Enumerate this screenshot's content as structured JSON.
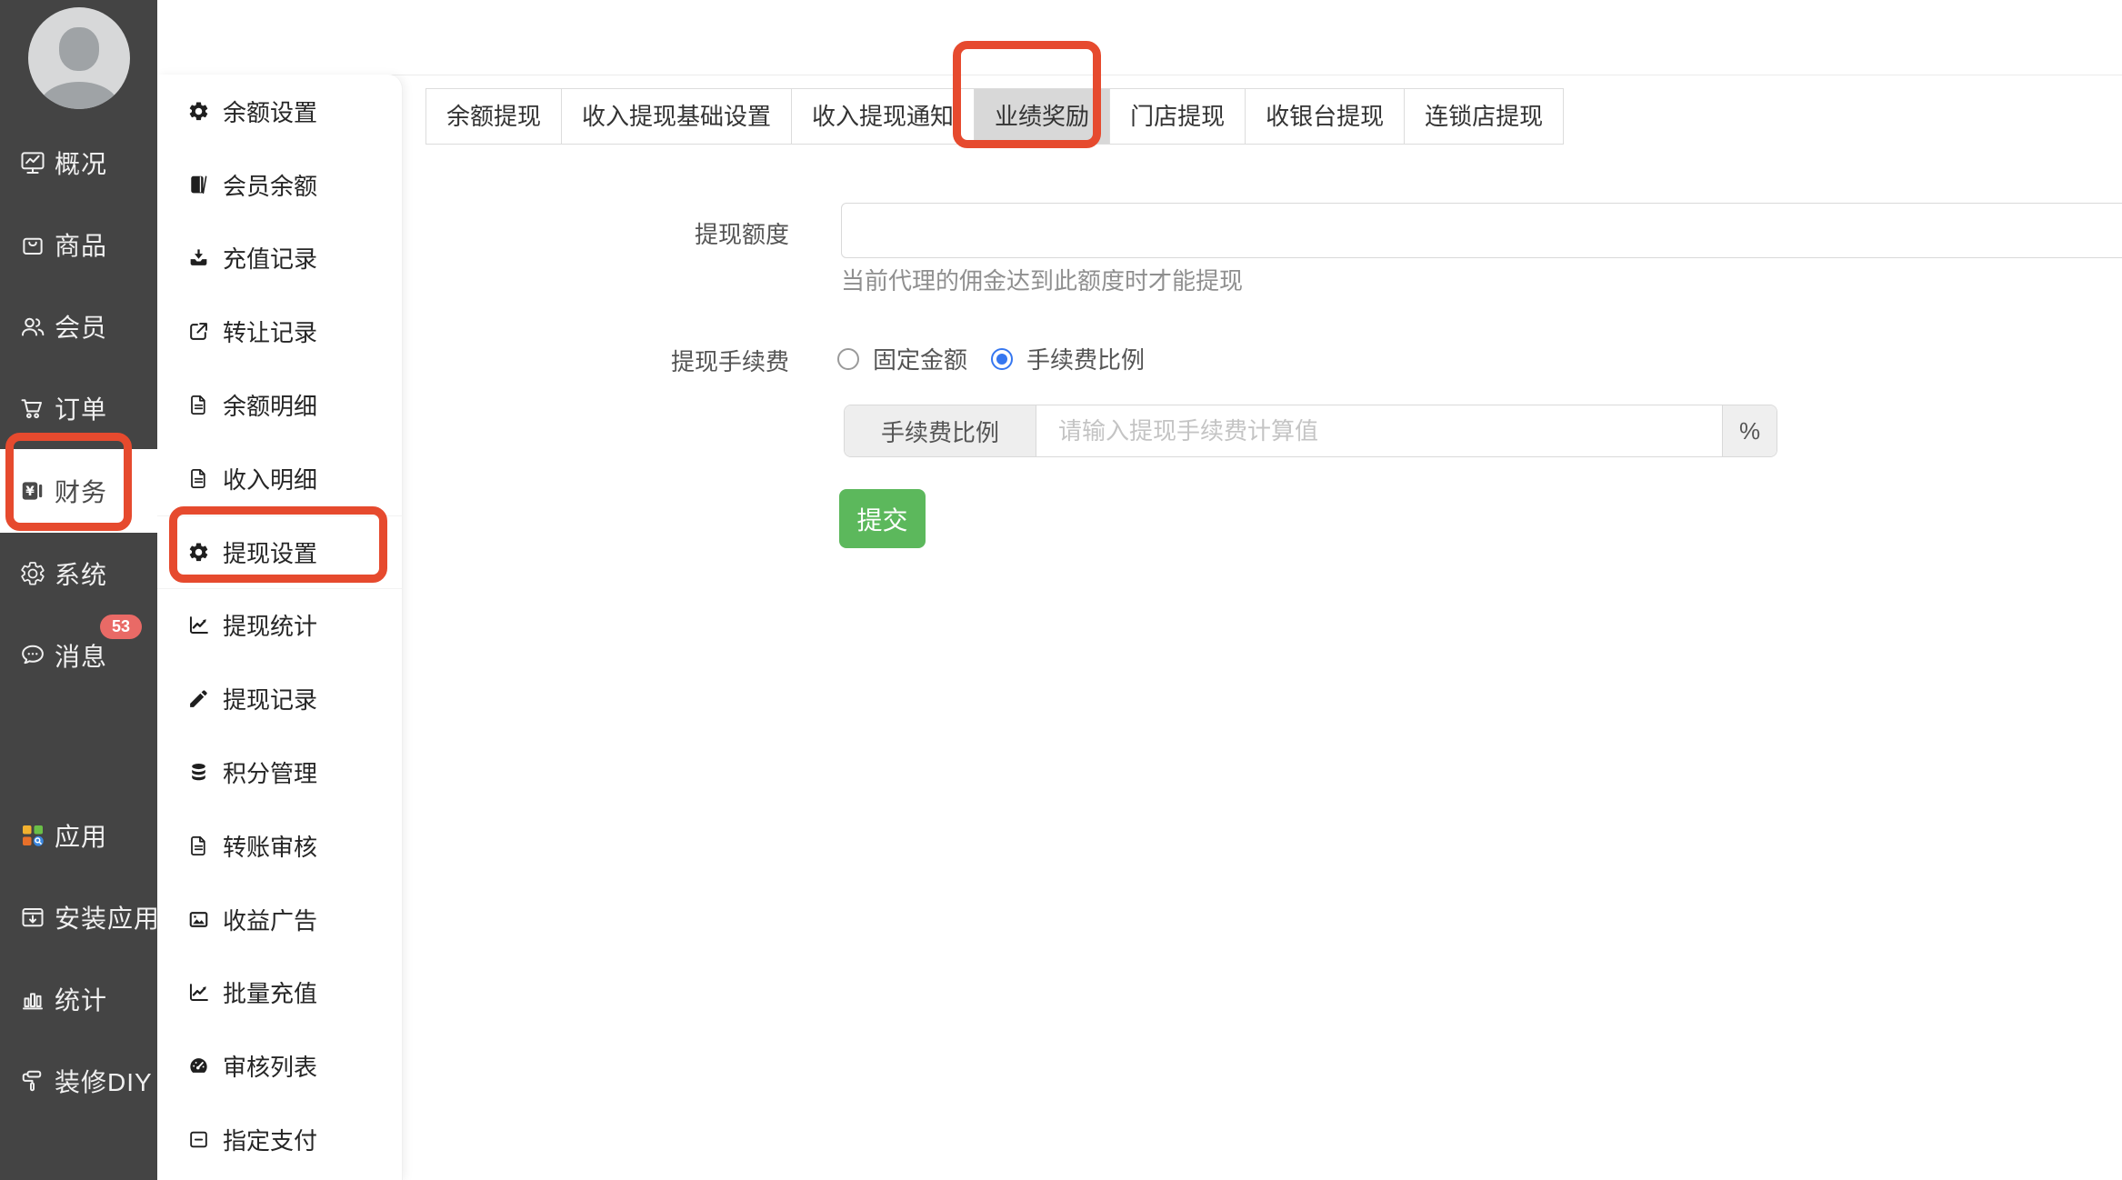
{
  "annotation_color": "#e64a2e",
  "sidebar": {
    "items": [
      {
        "label": "概况",
        "icon": "overview-icon"
      },
      {
        "label": "商品",
        "icon": "goods-icon"
      },
      {
        "label": "会员",
        "icon": "members-icon"
      },
      {
        "label": "订单",
        "icon": "orders-icon"
      },
      {
        "label": "财务",
        "icon": "finance-icon",
        "active": true
      },
      {
        "label": "系统",
        "icon": "system-icon"
      },
      {
        "label": "消息",
        "icon": "messages-icon",
        "badge": "53"
      },
      {
        "label": "应用",
        "icon": "apps-icon",
        "spacer_before": true
      },
      {
        "label": "安装应用",
        "icon": "install-app-icon"
      },
      {
        "label": "统计",
        "icon": "statistics-icon"
      },
      {
        "label": "装修DIY",
        "icon": "decorate-diy-icon"
      }
    ]
  },
  "submenu": {
    "items": [
      {
        "label": "余额设置",
        "icon": "gear-icon"
      },
      {
        "label": "会员余额",
        "icon": "book-icon"
      },
      {
        "label": "充值记录",
        "icon": "download-icon"
      },
      {
        "label": "转让记录",
        "icon": "external-link-icon"
      },
      {
        "label": "余额明细",
        "icon": "document-icon"
      },
      {
        "label": "收入明细",
        "icon": "document-icon"
      },
      {
        "label": "提现设置",
        "icon": "gear-icon",
        "active": true
      },
      {
        "label": "提现统计",
        "icon": "chart-icon"
      },
      {
        "label": "提现记录",
        "icon": "pencil-icon"
      },
      {
        "label": "积分管理",
        "icon": "coins-icon"
      },
      {
        "label": "转账审核",
        "icon": "document-icon"
      },
      {
        "label": "收益广告",
        "icon": "image-icon"
      },
      {
        "label": "批量充值",
        "icon": "chart-icon"
      },
      {
        "label": "审核列表",
        "icon": "dashboard-icon"
      },
      {
        "label": "指定支付",
        "icon": "minus-square-icon"
      }
    ]
  },
  "tabs": {
    "items": [
      "余额提现",
      "收入提现基础设置",
      "收入提现通知",
      "业绩奖励",
      "门店提现",
      "收银台提现",
      "连锁店提现"
    ],
    "active_index": 3
  },
  "form": {
    "quota_label": "提现额度",
    "quota_value": "",
    "quota_hint": "当前代理的佣金达到此额度时才能提现",
    "fee_label": "提现手续费",
    "fee_options": [
      {
        "label": "固定金额",
        "selected": false
      },
      {
        "label": "手续费比例",
        "selected": true
      }
    ],
    "rate_addon": "手续费比例",
    "rate_placeholder": "请输入提现手续费计算值",
    "rate_suffix": "%",
    "submit_label": "提交"
  }
}
